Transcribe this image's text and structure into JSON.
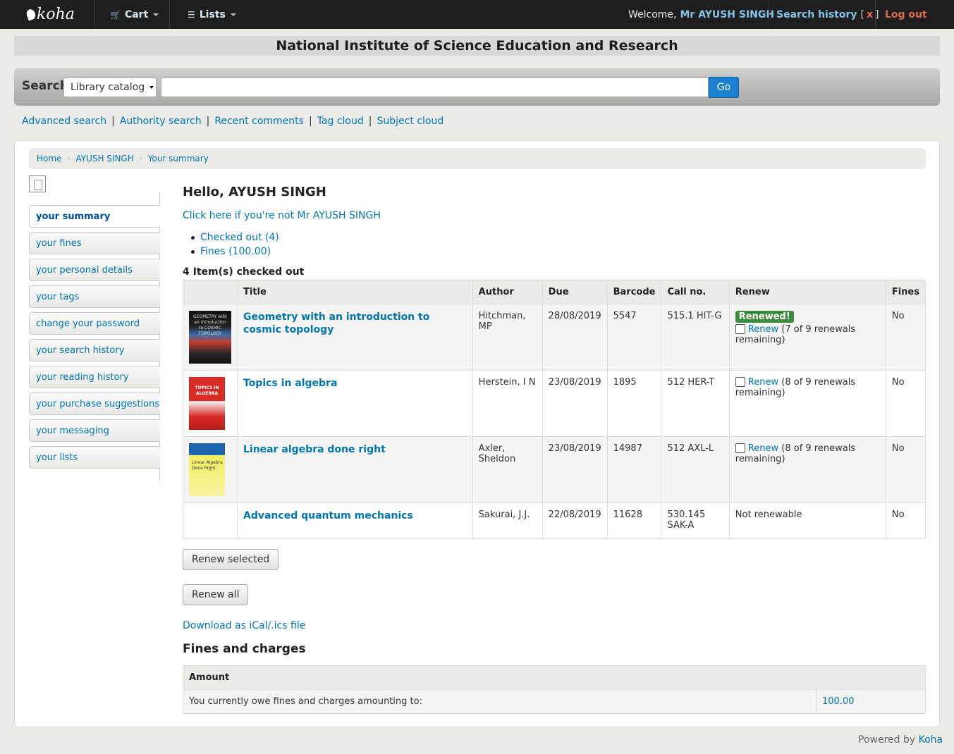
{
  "navbar": {
    "logo": "koha",
    "cart": "Cart",
    "lists": "Lists",
    "welcome": "Welcome,",
    "user": "Mr AYUSH SINGH",
    "search_history": "Search history",
    "search_history_open": "[",
    "search_history_clear": "x",
    "search_history_close": "]",
    "logout": "Log out"
  },
  "library_name": "National Institute of Science Education and Research",
  "search": {
    "label": "Search",
    "scope": "Library catalog",
    "query": "",
    "go": "Go"
  },
  "sublinks": [
    "Advanced search",
    "Authority search",
    "Recent comments",
    "Tag cloud",
    "Subject cloud"
  ],
  "breadcrumb": [
    "Home",
    "AYUSH SINGH",
    "Your summary"
  ],
  "usermenu": [
    "your summary",
    "your fines",
    "your personal details",
    "your tags",
    "change your password",
    "your search history",
    "your reading history",
    "your purchase suggestions",
    "your messaging",
    "your lists"
  ],
  "main": {
    "hello": "Hello, AYUSH SINGH",
    "not_me": "Click here if you're not Mr AYUSH SINGH",
    "summary_links": [
      "Checked out (4)",
      "Fines (100.00)"
    ],
    "checked_out_heading": "4 Item(s) checked out",
    "columns": [
      "",
      "Title",
      "Author",
      "Due",
      "Barcode",
      "Call no.",
      "Renew",
      "Fines"
    ],
    "items": [
      {
        "cover_text": "GEOMETRY with an introduction to COSMIC TOPOLOGY",
        "title": "Geometry with an introduction to cosmic topology",
        "author": "Hitchman, MP",
        "due": "28/08/2019",
        "barcode": "5547",
        "call_no": "515.1 HIT-G",
        "renewed_badge": "Renewed!",
        "renew_link": "Renew",
        "renew_note": "(7 of 9 renewals remaining)",
        "fines": "No"
      },
      {
        "cover_text": "TOPICS IN ALGEBRA",
        "title": "Topics in algebra",
        "author": "Herstein, I N",
        "due": "23/08/2019",
        "barcode": "1895",
        "call_no": "512 HER-T",
        "renew_link": "Renew",
        "renew_note": "(8 of 9 renewals remaining)",
        "fines": "No"
      },
      {
        "cover_text": "Linear Algebra Done Right",
        "title": "Linear algebra done right",
        "author": "Axler, Sheldon",
        "due": "23/08/2019",
        "barcode": "14987",
        "call_no": "512 AXL-L",
        "renew_link": "Renew",
        "renew_note": "(8 of 9 renewals remaining)",
        "fines": "No"
      },
      {
        "title": "Advanced quantum mechanics",
        "author": "Sakurai, J.J.",
        "due": "22/08/2019",
        "barcode": "11628",
        "call_no": "530.145 SAK-A",
        "renew_status": "Not renewable",
        "fines": "No"
      }
    ],
    "renew_selected": "Renew selected",
    "renew_all": "Renew all",
    "ical": "Download as iCal/.ics file",
    "fines_heading": "Fines and charges",
    "fines_column": "Amount",
    "fines_text": "You currently owe fines and charges amounting to:",
    "fines_amount": "100.00"
  },
  "footer": {
    "powered_by": "Powered by",
    "koha": "Koha"
  }
}
